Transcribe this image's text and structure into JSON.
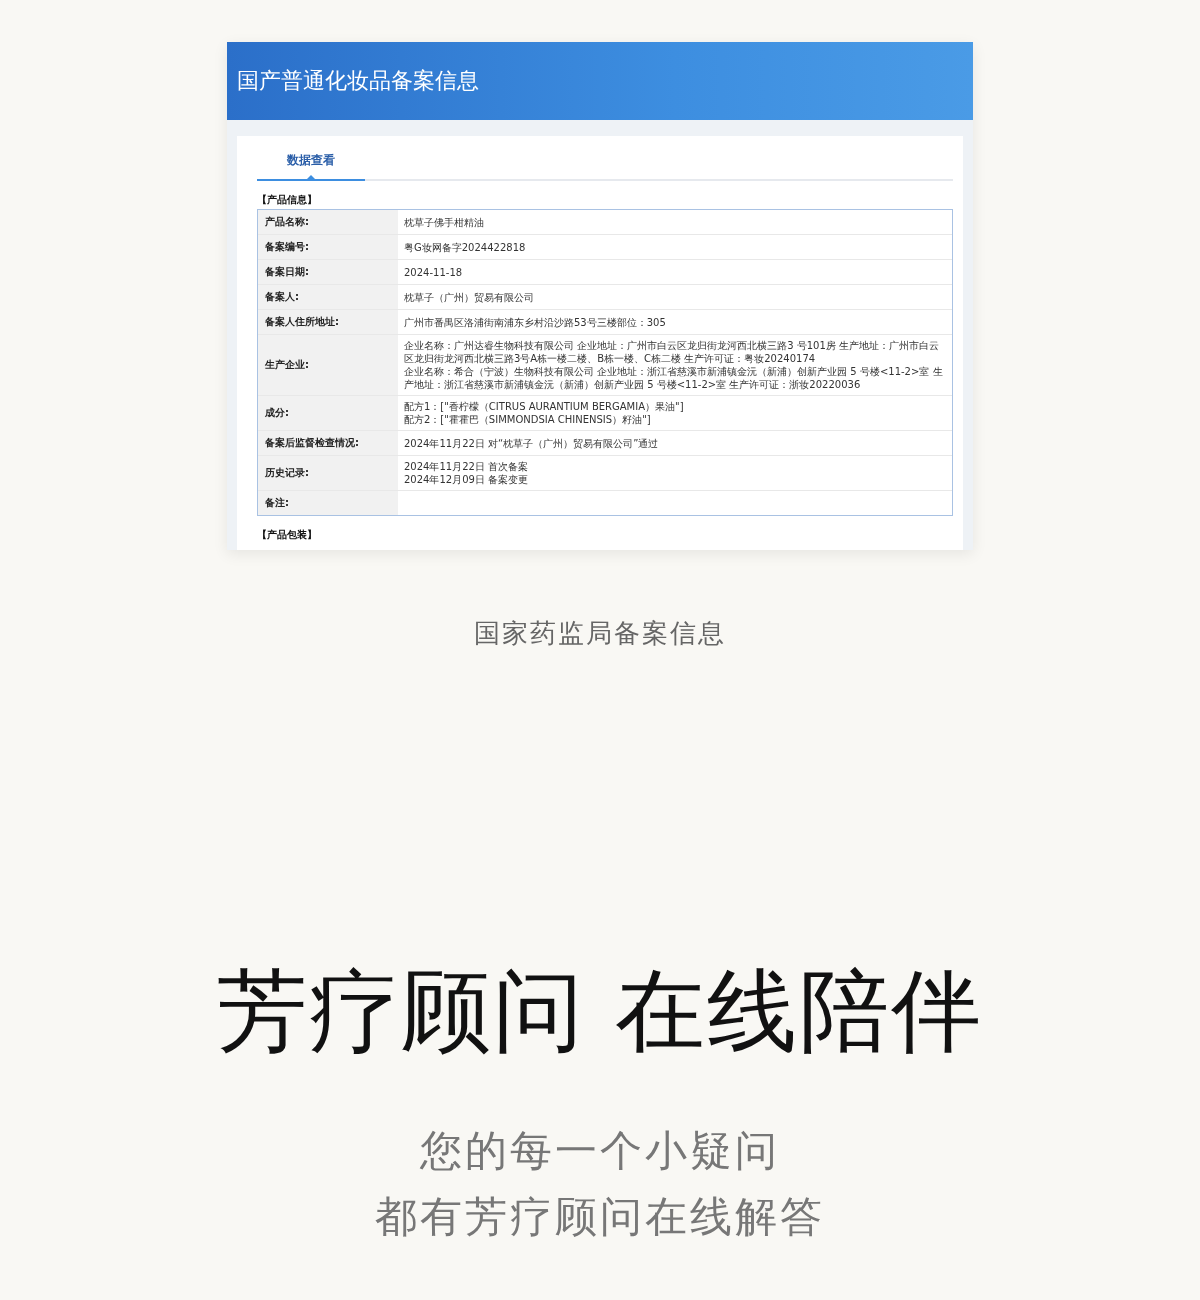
{
  "header": {
    "title": "国产普通化妆品备案信息"
  },
  "tabs": [
    {
      "label": "数据查看",
      "selected": true
    }
  ],
  "sections": [
    {
      "title": "【产品信息】",
      "rows": [
        {
          "label": "产品名称:",
          "lines": [
            "枕草子佛手柑精油"
          ]
        },
        {
          "label": "备案编号:",
          "lines": [
            "粤G妆网备字2024422818"
          ]
        },
        {
          "label": "备案日期:",
          "lines": [
            "2024-11-18"
          ]
        },
        {
          "label": "备案人:",
          "lines": [
            "枕草子（广州）贸易有限公司"
          ]
        },
        {
          "label": "备案人住所地址:",
          "lines": [
            "广州市番禺区洛浦街南浦东乡村沿沙路53号三楼部位：305"
          ]
        },
        {
          "label": "生产企业:",
          "lines": [
            "企业名称：广州达睿生物科技有限公司 企业地址：广州市白云区龙归街龙河西北横三路3 号101房 生产地址：广州市白云区龙归街龙河西北横三路3号A栋一楼二楼、B栋一楼、C栋二楼 生产许可证：粤妆20240174",
            "企业名称：希合（宁波）生物科技有限公司 企业地址：浙江省慈溪市新浦镇金沅（新浦）创新产业园 5 号楼<11-2>室 生产地址：浙江省慈溪市新浦镇金沅（新浦）创新产业园 5 号楼<11-2>室 生产许可证：浙妆20220036"
          ]
        },
        {
          "label": "成分:",
          "lines": [
            "配方1：[\"香柠檬（CITRUS AURANTIUM BERGAMIA）果油\"]",
            "配方2：[\"霍霍巴（SIMMONDSIA CHINENSIS）籽油\"]"
          ]
        },
        {
          "label": "备案后监督检查情况:",
          "lines": [
            "2024年11月22日 对“枕草子（广州）贸易有限公司”通过"
          ]
        },
        {
          "label": "历史记录:",
          "lines": [
            "2024年11月22日 首次备案",
            "2024年12月09日 备案变更"
          ]
        },
        {
          "label": "备注:"
        }
      ]
    },
    {
      "title": "【产品包装】"
    }
  ],
  "caption": "国家药监局备案信息",
  "headline": "芳疗顾问 在线陪伴",
  "subtitle_lines": [
    "您的每一个小疑问",
    "都有芳疗顾问在线解答"
  ]
}
